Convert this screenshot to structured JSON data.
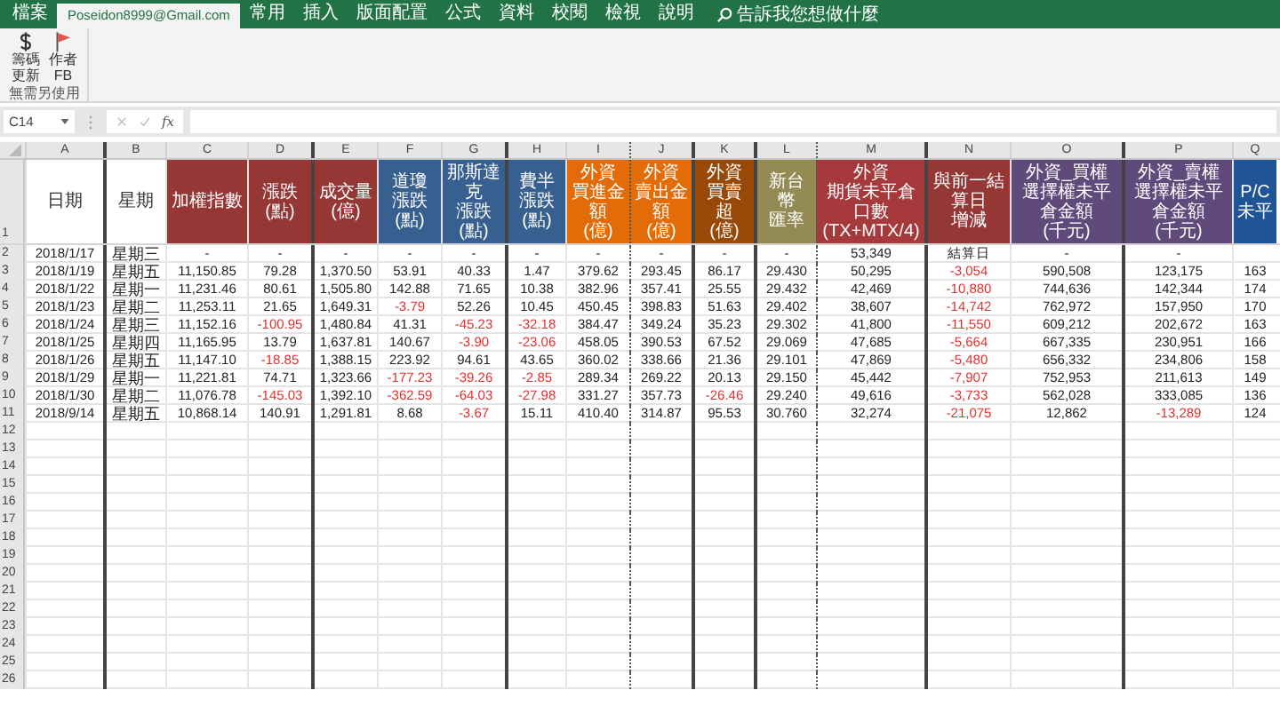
{
  "ribbon_tabs": [
    {
      "label": "檔案",
      "selected": false
    },
    {
      "label": "Poseidon8999@Gmail.com",
      "selected": true
    },
    {
      "label": "常用",
      "selected": false
    },
    {
      "label": "插入",
      "selected": false
    },
    {
      "label": "版面配置",
      "selected": false
    },
    {
      "label": "公式",
      "selected": false
    },
    {
      "label": "資料",
      "selected": false
    },
    {
      "label": "校閱",
      "selected": false
    },
    {
      "label": "檢視",
      "selected": false
    },
    {
      "label": "說明",
      "selected": false
    }
  ],
  "tell_me": {
    "placeholder": "告訴我您想做什麼"
  },
  "ribbon": {
    "buttons": [
      {
        "kind": "dollar",
        "label": [
          "籌碼",
          "更新"
        ]
      },
      {
        "kind": "flag",
        "label": [
          "作者",
          "FB"
        ]
      }
    ],
    "group_label": "無需另使用"
  },
  "formula_bar": {
    "name_box": "C14",
    "function_label": "fx"
  },
  "columns": [
    {
      "letter": "A",
      "header": [
        "日期"
      ]
    },
    {
      "letter": "B",
      "header": [
        "星期"
      ]
    },
    {
      "letter": "C",
      "header": [
        "加權指數"
      ],
      "color": "#953735"
    },
    {
      "letter": "D",
      "header": [
        "漲跌(點)"
      ],
      "color": "#953735"
    },
    {
      "letter": "E",
      "header": [
        "成交量(億)"
      ],
      "color": "#953735"
    },
    {
      "letter": "F",
      "header": [
        "道瓊",
        "漲跌(點)"
      ],
      "color": "#376091"
    },
    {
      "letter": "G",
      "header": [
        "那斯達克",
        "漲跌(點)"
      ],
      "color": "#376091"
    },
    {
      "letter": "H",
      "header": [
        "費半",
        "漲跌(點)"
      ],
      "color": "#376091"
    },
    {
      "letter": "I",
      "header": [
        "外資",
        "買進金額",
        "(億)"
      ],
      "color": "#e36c09"
    },
    {
      "letter": "J",
      "header": [
        "外資",
        "賣出金額",
        "(億)"
      ],
      "color": "#e36c09"
    },
    {
      "letter": "K",
      "header": [
        "外資",
        "買賣超",
        "(億)"
      ],
      "color": "#984807"
    },
    {
      "letter": "L",
      "header": [
        "新台幣",
        "匯率"
      ],
      "color": "#948a54"
    },
    {
      "letter": "M",
      "header": [
        "外資",
        "期貨未平倉口數",
        "(TX+MTX/4)"
      ],
      "color": "#a5393b"
    },
    {
      "letter": "N",
      "header": [
        "與前一結算日",
        "增減"
      ],
      "color": "#953735"
    },
    {
      "letter": "O",
      "header": [
        "外資_買權",
        "選擇權未平倉金額",
        "(千元)"
      ],
      "color": "#604a7b"
    },
    {
      "letter": "P",
      "header": [
        "外資_賣權",
        "選擇權未平倉金額",
        "(千元)"
      ],
      "color": "#604a7b"
    },
    {
      "letter": "Q",
      "header": [
        "P/C",
        "未平"
      ],
      "color": "#1f5597"
    }
  ],
  "header_row": "1",
  "rows": [
    {
      "row": "2",
      "cells": [
        {
          "text": "2018/1/17",
          "negative": false
        },
        {
          "text": "星期三",
          "negative": false
        },
        {
          "text": "-",
          "negative": false
        },
        {
          "text": "-",
          "negative": false
        },
        {
          "text": "-",
          "negative": false
        },
        {
          "text": "-",
          "negative": false
        },
        {
          "text": "-",
          "negative": false
        },
        {
          "text": "-",
          "negative": false
        },
        {
          "text": "-",
          "negative": false
        },
        {
          "text": "-",
          "negative": false
        },
        {
          "text": "-",
          "negative": false
        },
        {
          "text": "-",
          "negative": false
        },
        {
          "text": "53,349",
          "negative": false
        },
        {
          "text": "結算日",
          "negative": false
        },
        {
          "text": "-",
          "negative": false
        },
        {
          "text": "-",
          "negative": false
        }
      ]
    },
    {
      "row": "3",
      "cells": [
        {
          "text": "2018/1/19",
          "negative": false
        },
        {
          "text": "星期五",
          "negative": false
        },
        {
          "text": "11,150.85",
          "negative": false
        },
        {
          "text": "79.28",
          "negative": false
        },
        {
          "text": "1,370.50",
          "negative": false
        },
        {
          "text": "53.91",
          "negative": false
        },
        {
          "text": "40.33",
          "negative": false
        },
        {
          "text": "1.47",
          "negative": false
        },
        {
          "text": "379.62",
          "negative": false
        },
        {
          "text": "293.45",
          "negative": false
        },
        {
          "text": "86.17",
          "negative": false
        },
        {
          "text": "29.430",
          "negative": false
        },
        {
          "text": "50,295",
          "negative": false
        },
        {
          "text": "-3,054",
          "negative": true
        },
        {
          "text": "590,508",
          "negative": false
        },
        {
          "text": "123,175",
          "negative": false
        },
        {
          "text": "163",
          "negative": false
        }
      ]
    },
    {
      "row": "4",
      "cells": [
        {
          "text": "2018/1/22",
          "negative": false
        },
        {
          "text": "星期一",
          "negative": false
        },
        {
          "text": "11,231.46",
          "negative": false
        },
        {
          "text": "80.61",
          "negative": false
        },
        {
          "text": "1,505.80",
          "negative": false
        },
        {
          "text": "142.88",
          "negative": false
        },
        {
          "text": "71.65",
          "negative": false
        },
        {
          "text": "10.38",
          "negative": false
        },
        {
          "text": "382.96",
          "negative": false
        },
        {
          "text": "357.41",
          "negative": false
        },
        {
          "text": "25.55",
          "negative": false
        },
        {
          "text": "29.432",
          "negative": false
        },
        {
          "text": "42,469",
          "negative": false
        },
        {
          "text": "-10,880",
          "negative": true
        },
        {
          "text": "744,636",
          "negative": false
        },
        {
          "text": "142,344",
          "negative": false
        },
        {
          "text": "174",
          "negative": false
        }
      ]
    },
    {
      "row": "5",
      "cells": [
        {
          "text": "2018/1/23",
          "negative": false
        },
        {
          "text": "星期二",
          "negative": false
        },
        {
          "text": "11,253.11",
          "negative": false
        },
        {
          "text": "21.65",
          "negative": false
        },
        {
          "text": "1,649.31",
          "negative": false
        },
        {
          "text": "-3.79",
          "negative": true
        },
        {
          "text": "52.26",
          "negative": false
        },
        {
          "text": "10.45",
          "negative": false
        },
        {
          "text": "450.45",
          "negative": false
        },
        {
          "text": "398.83",
          "negative": false
        },
        {
          "text": "51.63",
          "negative": false
        },
        {
          "text": "29.402",
          "negative": false
        },
        {
          "text": "38,607",
          "negative": false
        },
        {
          "text": "-14,742",
          "negative": true
        },
        {
          "text": "762,972",
          "negative": false
        },
        {
          "text": "157,950",
          "negative": false
        },
        {
          "text": "170",
          "negative": false
        }
      ]
    },
    {
      "row": "6",
      "cells": [
        {
          "text": "2018/1/24",
          "negative": false
        },
        {
          "text": "星期三",
          "negative": false
        },
        {
          "text": "11,152.16",
          "negative": false
        },
        {
          "text": "-100.95",
          "negative": true
        },
        {
          "text": "1,480.84",
          "negative": false
        },
        {
          "text": "41.31",
          "negative": false
        },
        {
          "text": "-45.23",
          "negative": true
        },
        {
          "text": "-32.18",
          "negative": true
        },
        {
          "text": "384.47",
          "negative": false
        },
        {
          "text": "349.24",
          "negative": false
        },
        {
          "text": "35.23",
          "negative": false
        },
        {
          "text": "29.302",
          "negative": false
        },
        {
          "text": "41,800",
          "negative": false
        },
        {
          "text": "-11,550",
          "negative": true
        },
        {
          "text": "609,212",
          "negative": false
        },
        {
          "text": "202,672",
          "negative": false
        },
        {
          "text": "163",
          "negative": false
        }
      ]
    },
    {
      "row": "7",
      "cells": [
        {
          "text": "2018/1/25",
          "negative": false
        },
        {
          "text": "星期四",
          "negative": false
        },
        {
          "text": "11,165.95",
          "negative": false
        },
        {
          "text": "13.79",
          "negative": false
        },
        {
          "text": "1,637.81",
          "negative": false
        },
        {
          "text": "140.67",
          "negative": false
        },
        {
          "text": "-3.90",
          "negative": true
        },
        {
          "text": "-23.06",
          "negative": true
        },
        {
          "text": "458.05",
          "negative": false
        },
        {
          "text": "390.53",
          "negative": false
        },
        {
          "text": "67.52",
          "negative": false
        },
        {
          "text": "29.069",
          "negative": false
        },
        {
          "text": "47,685",
          "negative": false
        },
        {
          "text": "-5,664",
          "negative": true
        },
        {
          "text": "667,335",
          "negative": false
        },
        {
          "text": "230,951",
          "negative": false
        },
        {
          "text": "166",
          "negative": false
        }
      ]
    },
    {
      "row": "8",
      "cells": [
        {
          "text": "2018/1/26",
          "negative": false
        },
        {
          "text": "星期五",
          "negative": false
        },
        {
          "text": "11,147.10",
          "negative": false
        },
        {
          "text": "-18.85",
          "negative": true
        },
        {
          "text": "1,388.15",
          "negative": false
        },
        {
          "text": "223.92",
          "negative": false
        },
        {
          "text": "94.61",
          "negative": false
        },
        {
          "text": "43.65",
          "negative": false
        },
        {
          "text": "360.02",
          "negative": false
        },
        {
          "text": "338.66",
          "negative": false
        },
        {
          "text": "21.36",
          "negative": false
        },
        {
          "text": "29.101",
          "negative": false
        },
        {
          "text": "47,869",
          "negative": false
        },
        {
          "text": "-5,480",
          "negative": true
        },
        {
          "text": "656,332",
          "negative": false
        },
        {
          "text": "234,806",
          "negative": false
        },
        {
          "text": "158",
          "negative": false
        }
      ]
    },
    {
      "row": "9",
      "cells": [
        {
          "text": "2018/1/29",
          "negative": false
        },
        {
          "text": "星期一",
          "negative": false
        },
        {
          "text": "11,221.81",
          "negative": false
        },
        {
          "text": "74.71",
          "negative": false
        },
        {
          "text": "1,323.66",
          "negative": false
        },
        {
          "text": "-177.23",
          "negative": true
        },
        {
          "text": "-39.26",
          "negative": true
        },
        {
          "text": "-2.85",
          "negative": true
        },
        {
          "text": "289.34",
          "negative": false
        },
        {
          "text": "269.22",
          "negative": false
        },
        {
          "text": "20.13",
          "negative": false
        },
        {
          "text": "29.150",
          "negative": false
        },
        {
          "text": "45,442",
          "negative": false
        },
        {
          "text": "-7,907",
          "negative": true
        },
        {
          "text": "752,953",
          "negative": false
        },
        {
          "text": "211,613",
          "negative": false
        },
        {
          "text": "149",
          "negative": false
        }
      ]
    },
    {
      "row": "10",
      "cells": [
        {
          "text": "2018/1/30",
          "negative": false
        },
        {
          "text": "星期二",
          "negative": false
        },
        {
          "text": "11,076.78",
          "negative": false
        },
        {
          "text": "-145.03",
          "negative": true
        },
        {
          "text": "1,392.10",
          "negative": false
        },
        {
          "text": "-362.59",
          "negative": true
        },
        {
          "text": "-64.03",
          "negative": true
        },
        {
          "text": "-27.98",
          "negative": true
        },
        {
          "text": "331.27",
          "negative": false
        },
        {
          "text": "357.73",
          "negative": false
        },
        {
          "text": "-26.46",
          "negative": true
        },
        {
          "text": "29.240",
          "negative": false
        },
        {
          "text": "49,616",
          "negative": false
        },
        {
          "text": "-3,733",
          "negative": true
        },
        {
          "text": "562,028",
          "negative": false
        },
        {
          "text": "333,085",
          "negative": false
        },
        {
          "text": "136",
          "negative": false
        }
      ]
    },
    {
      "row": "11",
      "cells": [
        {
          "text": "2018/9/14",
          "negative": false
        },
        {
          "text": "星期五",
          "negative": false
        },
        {
          "text": "10,868.14",
          "negative": false
        },
        {
          "text": "140.91",
          "negative": false
        },
        {
          "text": "1,291.81",
          "negative": false
        },
        {
          "text": "8.68",
          "negative": false
        },
        {
          "text": "-3.67",
          "negative": true
        },
        {
          "text": "15.11",
          "negative": false
        },
        {
          "text": "410.40",
          "negative": false
        },
        {
          "text": "314.87",
          "negative": false
        },
        {
          "text": "95.53",
          "negative": false
        },
        {
          "text": "30.760",
          "negative": false
        },
        {
          "text": "32,274",
          "negative": false
        },
        {
          "text": "-21,075",
          "negative": true
        },
        {
          "text": "12,862",
          "negative": false
        },
        {
          "text": "-13,289",
          "negative": true
        },
        {
          "text": "124",
          "negative": false
        }
      ]
    }
  ],
  "empty_rows": [
    "12",
    "13",
    "14",
    "15",
    "16",
    "17",
    "18",
    "19",
    "20",
    "21",
    "22",
    "23",
    "24",
    "25",
    "26"
  ]
}
